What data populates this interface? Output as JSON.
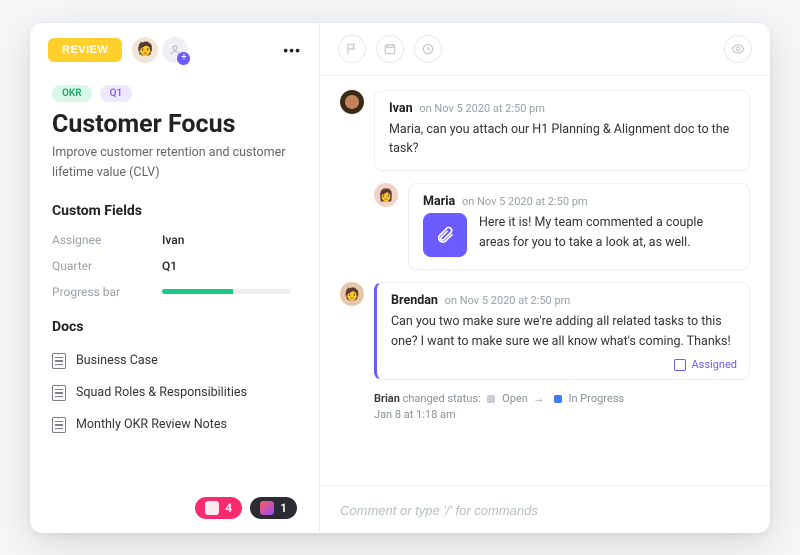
{
  "header": {
    "review_label": "REVIEW"
  },
  "tags": {
    "okr": "OKR",
    "q1": "Q1"
  },
  "title": "Customer Focus",
  "subtitle": "Improve customer retention and customer lifetime value (CLV)",
  "custom_fields": {
    "heading": "Custom Fields",
    "assignee_label": "Assignee",
    "assignee_value": "Ivan",
    "quarter_label": "Quarter",
    "quarter_value": "Q1",
    "progress_label": "Progress bar",
    "progress_percent": 55
  },
  "docs": {
    "heading": "Docs",
    "items": [
      {
        "label": "Business Case"
      },
      {
        "label": "Squad Roles & Responsibilities"
      },
      {
        "label": "Monthly OKR Review Notes"
      }
    ]
  },
  "footer_pills": {
    "a_count": "4",
    "b_count": "1"
  },
  "feed": {
    "items": [
      {
        "author": "Ivan",
        "meta": "on Nov 5 2020 at 2:50 pm",
        "body": "Maria, can you attach our H1 Planning & Alignment doc to the task?"
      },
      {
        "author": "Maria",
        "meta": "on Nov 5 2020 at 2:50 pm",
        "body": "Here it is! My team commented a couple areas for you to take a look at, as well."
      },
      {
        "author": "Brendan",
        "meta": "on Nov 5 2020 at 2:50 pm",
        "body": "Can you two make sure we're adding all related tasks to this one? I want to make sure we all know what's coming. Thanks!",
        "assigned_label": "Assigned"
      }
    ],
    "status": {
      "actor": "Brian",
      "verb": "changed status:",
      "from": "Open",
      "to": "In Progress",
      "timestamp": "Jan 8 at 1:18 am",
      "from_color": "#c9cdd3",
      "to_color": "#3f7afc"
    }
  },
  "comment_placeholder": "Comment or type '/' for commands"
}
